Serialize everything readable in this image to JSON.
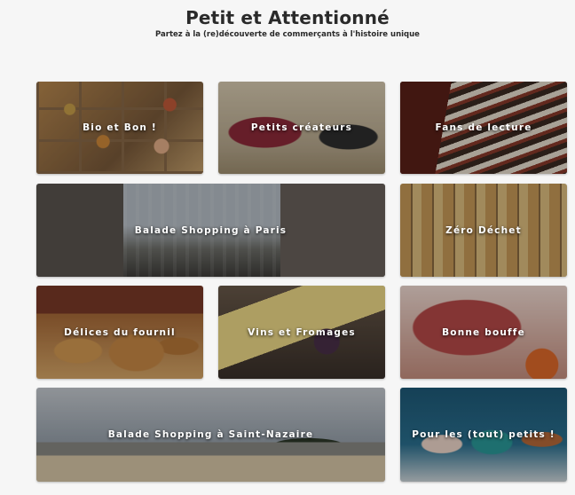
{
  "header": {
    "title": "Petit et Attentionné",
    "subtitle": "Partez à la (re)découverte de commerçants à l'histoire unique"
  },
  "tiles": [
    {
      "label": "Bio et Bon !"
    },
    {
      "label": "Petits créateurs"
    },
    {
      "label": "Fans de lecture"
    },
    {
      "label": "Balade Shopping à Paris"
    },
    {
      "label": "Zéro Déchet"
    },
    {
      "label": "Délices du fournil"
    },
    {
      "label": "Vins et Fromages"
    },
    {
      "label": "Bonne bouffe"
    },
    {
      "label": "Balade Shopping à Saint-Nazaire"
    },
    {
      "label": "Pour les (tout) petits !"
    }
  ]
}
